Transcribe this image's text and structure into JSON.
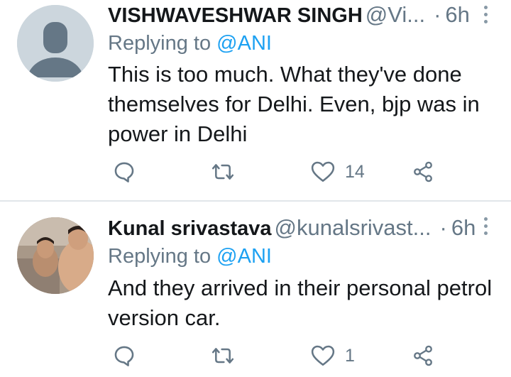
{
  "tweets": [
    {
      "name": "VISHWAVESHWAR SINGH",
      "handle": "@Vi...",
      "time": "6h",
      "reply_prefix": "Replying to",
      "reply_mention": "@ANI",
      "text_lines": [
        "This is too much. What they've done",
        "themselves for Delhi. Even, bjp was in",
        "power in Delhi"
      ],
      "like_count": "14",
      "avatar": "default-avatar"
    },
    {
      "name": "Kunal srivastava",
      "handle": "@kunalsrivast...",
      "time": "6h",
      "reply_prefix": "Replying to",
      "reply_mention": "@ANI",
      "text_lines": [
        "And they arrived in their personal petrol",
        "version car."
      ],
      "like_count": "1",
      "avatar": "photo-avatar"
    }
  ],
  "separator": "·",
  "colors": {
    "text_primary": "#14171a",
    "text_secondary": "#657786",
    "link": "#1da1f2",
    "divider": "#e1e6ea",
    "icon": "#657786"
  }
}
